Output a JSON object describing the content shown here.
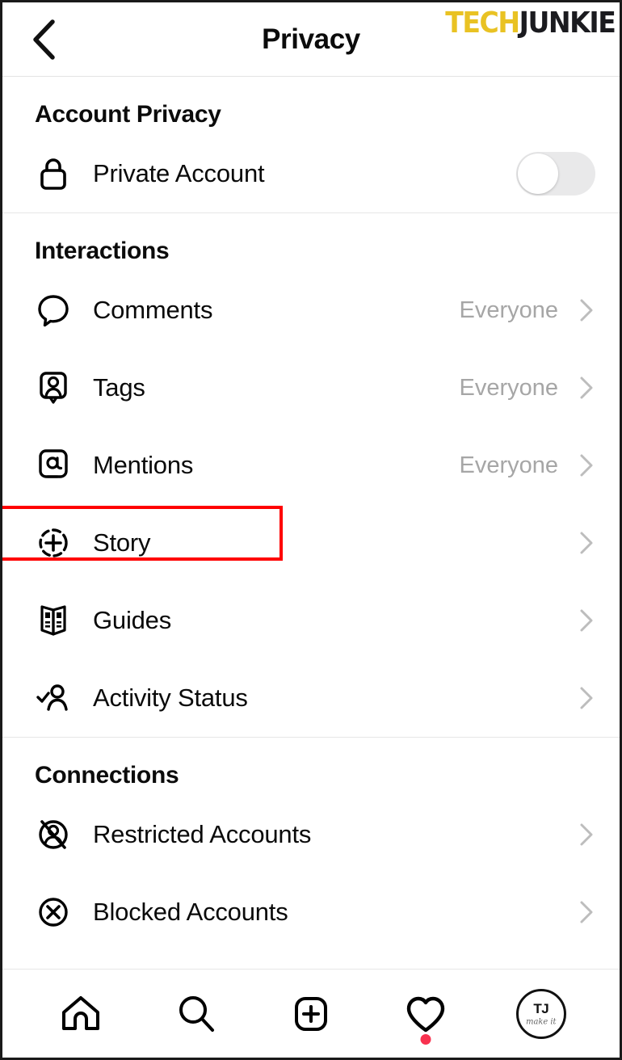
{
  "header": {
    "back_icon": "chevron-left-icon",
    "title": "Privacy",
    "watermark": {
      "part1": "TECH",
      "part2": "JUNKIE",
      "color1": "#E9C223",
      "color2": "#1b1b1f"
    }
  },
  "sections": [
    {
      "title": "Account Privacy",
      "rows": [
        {
          "icon": "lock-icon",
          "label": "Private Account",
          "control": "toggle",
          "toggle_on": false
        }
      ]
    },
    {
      "title": "Interactions",
      "rows": [
        {
          "icon": "comment-icon",
          "label": "Comments",
          "value": "Everyone",
          "control": "chevron"
        },
        {
          "icon": "tag-person-icon",
          "label": "Tags",
          "value": "Everyone",
          "control": "chevron"
        },
        {
          "icon": "at-mention-icon",
          "label": "Mentions",
          "value": "Everyone",
          "control": "chevron"
        },
        {
          "icon": "story-plus-icon",
          "label": "Story",
          "value": "",
          "control": "chevron",
          "highlighted": true
        },
        {
          "icon": "guides-book-icon",
          "label": "Guides",
          "value": "",
          "control": "chevron"
        },
        {
          "icon": "activity-status-icon",
          "label": "Activity Status",
          "value": "",
          "control": "chevron"
        }
      ]
    },
    {
      "title": "Connections",
      "rows": [
        {
          "icon": "restricted-account-icon",
          "label": "Restricted Accounts",
          "value": "",
          "control": "chevron"
        },
        {
          "icon": "blocked-account-icon",
          "label": "Blocked Accounts",
          "value": "",
          "control": "chevron"
        }
      ]
    }
  ],
  "navbar": {
    "items": [
      {
        "icon": "home-icon",
        "label": "Home"
      },
      {
        "icon": "search-icon",
        "label": "Search"
      },
      {
        "icon": "add-post-icon",
        "label": "Create"
      },
      {
        "icon": "heart-activity-icon",
        "label": "Activity",
        "badge": true
      },
      {
        "icon": "profile-avatar-icon",
        "label": "Profile"
      }
    ],
    "avatar": {
      "initials": "TJ",
      "tagline": "make it"
    }
  },
  "highlight": {
    "color": "#FF0000",
    "target": "Story"
  }
}
